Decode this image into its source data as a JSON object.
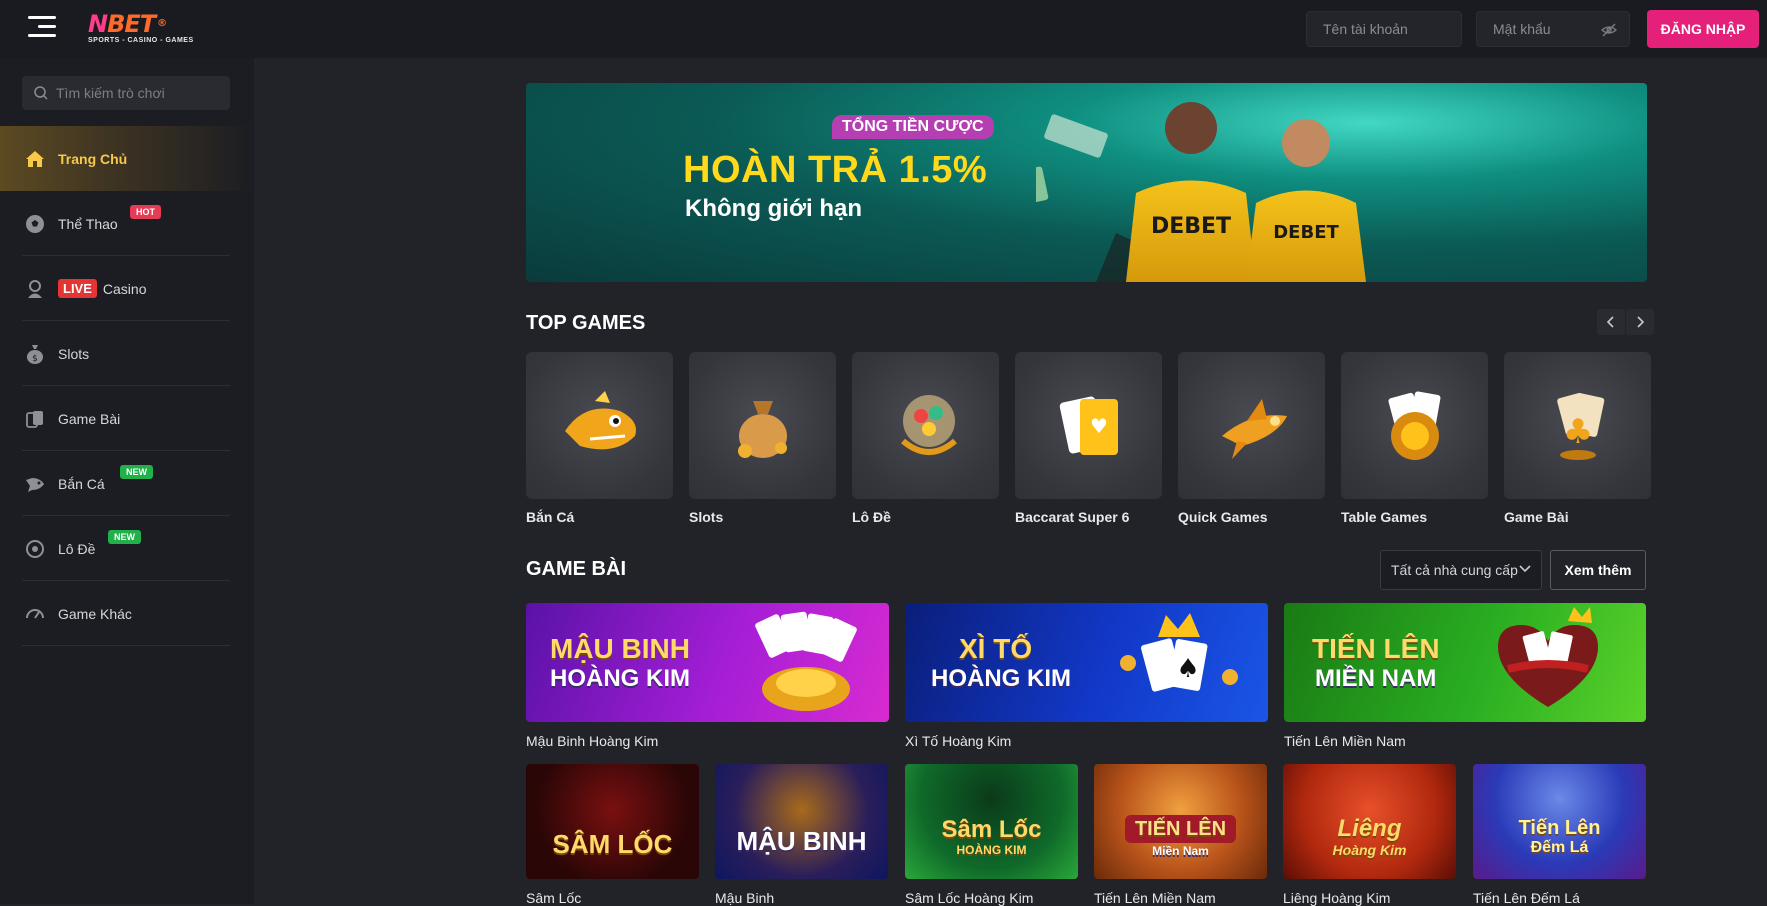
{
  "header": {
    "logo_word_n": "N",
    "logo_word_bet": "BET",
    "logo_reg": "®",
    "logo_tagline": "SPORTS - CASINO - GAMES",
    "username_placeholder": "Tên tài khoản",
    "password_placeholder": "Mật khẩu",
    "login_label": "ĐĂNG NHẬP"
  },
  "sidebar": {
    "search_placeholder": "Tìm kiếm trò chơi",
    "items": [
      {
        "label": "Trang Chủ",
        "icon": "home-icon"
      },
      {
        "label": "Thể Thao",
        "icon": "soccer-ball-icon",
        "badge": "HOT"
      },
      {
        "label": "Casino",
        "icon": "dealer-icon",
        "prefix": "LIVE"
      },
      {
        "label": "Slots",
        "icon": "money-bag-icon"
      },
      {
        "label": "Game Bài",
        "icon": "cards-icon"
      },
      {
        "label": "Bắn Cá",
        "icon": "fish-icon",
        "badge": "NEW"
      },
      {
        "label": "Lô Đề",
        "icon": "lottery-ball-icon",
        "badge": "NEW"
      },
      {
        "label": "Game Khác",
        "icon": "gauge-icon"
      }
    ]
  },
  "banner": {
    "tag": "TỔNG TIỀN CƯỢC",
    "title": "HOÀN TRẢ 1.5%",
    "subtitle": "Không giới hạn",
    "shirt_text": "DEBET"
  },
  "top_games": {
    "title": "TOP GAMES",
    "items": [
      "Bắn Cá",
      "Slots",
      "Lô Đề",
      "Baccarat Super 6",
      "Quick Games",
      "Table Games",
      "Game Bài"
    ]
  },
  "game_bai": {
    "title": "GAME BÀI",
    "provider_select": "Tất cả nhà cung cấp",
    "see_more": "Xem thêm",
    "featured": [
      {
        "line1": "MẬU BINH",
        "line2": "HOÀNG KIM",
        "caption": "Mậu Binh Hoàng Kim",
        "bg": "#9b1fd0"
      },
      {
        "line1": "XÌ TỐ",
        "line2": "HOÀNG KIM",
        "caption": "Xì Tố Hoàng Kim",
        "bg": "#1230b8"
      },
      {
        "line1": "TIẾN LÊN",
        "line2": "MIỀN NAM",
        "caption": "Tiến Lên Miền Nam",
        "bg": "#25a81f"
      }
    ],
    "small": [
      {
        "line1": "SÂM LỐC",
        "line2": "",
        "caption": "Sâm Lốc",
        "bg": "#3a0a0a"
      },
      {
        "line1": "MẬU BINH",
        "line2": "",
        "caption": "Mậu Binh",
        "bg": "#0f1e6a"
      },
      {
        "line1": "Sâm Lốc",
        "line2": "HOÀNG KIM",
        "caption": "Sâm Lốc Hoàng Kim",
        "bg": "#0e5a2a"
      },
      {
        "line1": "TIẾN LÊN",
        "line2": "Miền Nam",
        "caption": "Tiến Lên Miền Nam",
        "bg": "#b8531a"
      },
      {
        "line1": "Liêng",
        "line2": "Hoàng Kim",
        "caption": "Liêng Hoàng Kim",
        "bg": "#c23a14"
      },
      {
        "line1": "Tiến Lên",
        "line2": "Đếm Lá",
        "caption": "Tiến Lên Đếm Lá",
        "bg": "#2a3ab8"
      }
    ]
  },
  "colors": {
    "accent_pink": "#e5207a",
    "active_gold": "#f8c84a",
    "hot_badge": "#e63b55",
    "new_badge": "#22b04b",
    "live_tag": "#e53434"
  }
}
